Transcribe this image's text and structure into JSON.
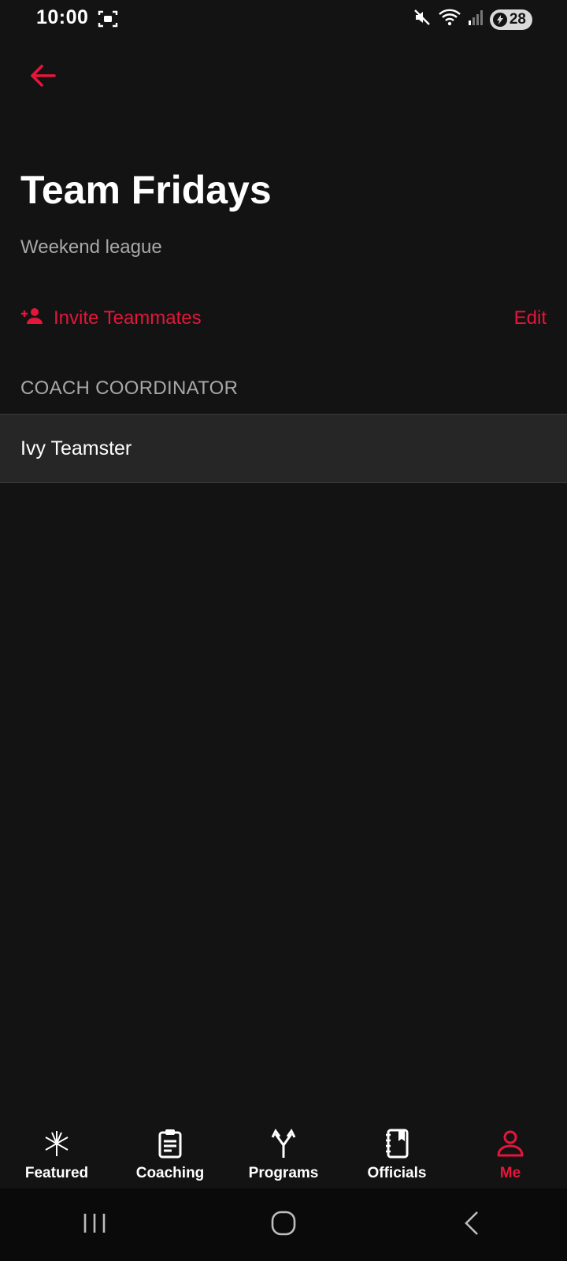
{
  "status_bar": {
    "time": "10:00",
    "battery_level": "28",
    "icons": [
      "screenshot-icon",
      "mute-icon",
      "wifi-icon",
      "signal-icon",
      "battery-icon"
    ]
  },
  "header": {
    "back_icon": "arrow-left-icon",
    "title": "Team Fridays",
    "subtitle": "Weekend league"
  },
  "actions": {
    "invite_label": "Invite Teammates",
    "invite_icon": "person-add-icon",
    "edit_label": "Edit"
  },
  "section": {
    "header": "COACH COORDINATOR",
    "members": [
      "Ivy Teamster"
    ]
  },
  "bottom_nav": {
    "items": [
      {
        "label": "Featured",
        "icon": "featured-icon",
        "active": false
      },
      {
        "label": "Coaching",
        "icon": "clipboard-icon",
        "active": false
      },
      {
        "label": "Programs",
        "icon": "split-arrows-icon",
        "active": false
      },
      {
        "label": "Officials",
        "icon": "book-icon",
        "active": false
      },
      {
        "label": "Me",
        "icon": "person-icon",
        "active": true
      }
    ]
  },
  "colors": {
    "accent": "#e4163a",
    "background": "#131313",
    "row_background": "#262626",
    "muted_text": "#a8a8a8"
  }
}
